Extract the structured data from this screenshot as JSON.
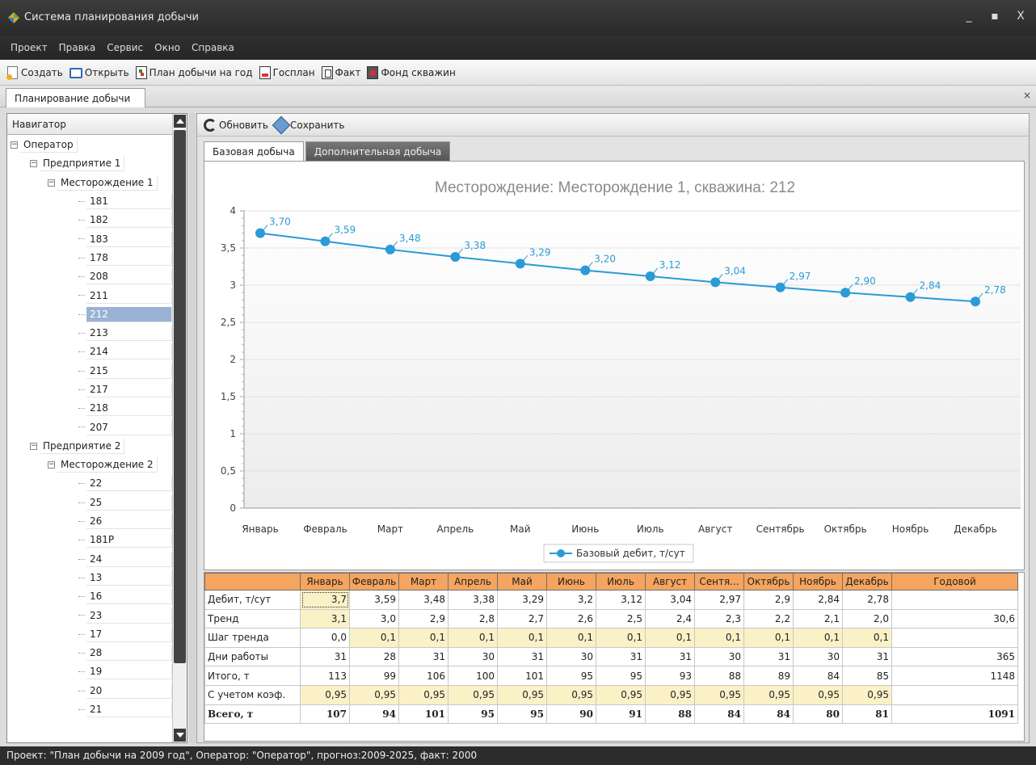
{
  "window": {
    "title": "Система планирования добычи",
    "controls": [
      "_",
      "▪",
      "X"
    ]
  },
  "menu": [
    "Проект",
    "Правка",
    "Сервис",
    "Окно",
    "Справка"
  ],
  "toolbar": {
    "create": "Создать",
    "open": "Открыть",
    "plan_year": "План добычи на год",
    "gosplan": "Госплан",
    "fact": "Факт",
    "well_fund": "Фонд скважин"
  },
  "doc_tab": {
    "label": "Планирование добычи",
    "close": "×"
  },
  "navigator": {
    "header": "Навигатор",
    "tree": [
      {
        "label": "Оператор",
        "level": 0,
        "expandable": true
      },
      {
        "label": "Предприятие 1",
        "level": 1,
        "expandable": true
      },
      {
        "label": "Месторождение 1",
        "level": 2,
        "expandable": true
      },
      {
        "label": "181",
        "level": 3
      },
      {
        "label": "182",
        "level": 3
      },
      {
        "label": "183",
        "level": 3
      },
      {
        "label": "178",
        "level": 3
      },
      {
        "label": "208",
        "level": 3
      },
      {
        "label": "211",
        "level": 3
      },
      {
        "label": "212",
        "level": 3,
        "selected": true
      },
      {
        "label": "213",
        "level": 3
      },
      {
        "label": "214",
        "level": 3
      },
      {
        "label": "215",
        "level": 3
      },
      {
        "label": "217",
        "level": 3
      },
      {
        "label": "218",
        "level": 3
      },
      {
        "label": "207",
        "level": 3
      },
      {
        "label": "Предприятие 2",
        "level": 1,
        "expandable": true
      },
      {
        "label": "Месторождение 2",
        "level": 2,
        "expandable": true
      },
      {
        "label": "22",
        "level": 3
      },
      {
        "label": "25",
        "level": 3
      },
      {
        "label": "26",
        "level": 3
      },
      {
        "label": "181P",
        "level": 3
      },
      {
        "label": "24",
        "level": 3
      },
      {
        "label": "13",
        "level": 3
      },
      {
        "label": "16",
        "level": 3
      },
      {
        "label": "23",
        "level": 3
      },
      {
        "label": "17",
        "level": 3
      },
      {
        "label": "28",
        "level": 3
      },
      {
        "label": "19",
        "level": 3
      },
      {
        "label": "20",
        "level": 3
      },
      {
        "label": "21",
        "level": 3
      }
    ]
  },
  "content_toolbar": {
    "refresh": "Обновить",
    "save": "Сохранить"
  },
  "tabs": [
    {
      "label": "Базовая добыча",
      "active": true
    },
    {
      "label": "Дополнительная добыча",
      "active": false
    }
  ],
  "chart_data": {
    "type": "line",
    "title": "Месторождение: Месторождение 1, скважина: 212",
    "categories": [
      "Январь",
      "Февраль",
      "Март",
      "Апрель",
      "Май",
      "Июнь",
      "Июль",
      "Август",
      "Сентябрь",
      "Октябрь",
      "Ноябрь",
      "Декабрь"
    ],
    "series": [
      {
        "name": "Базовый дебит, т/сут",
        "values": [
          3.7,
          3.59,
          3.48,
          3.38,
          3.29,
          3.2,
          3.12,
          3.04,
          2.97,
          2.9,
          2.84,
          2.78
        ],
        "labels": [
          "3,70",
          "3,59",
          "3,48",
          "3,38",
          "3,29",
          "3,20",
          "3,12",
          "3,04",
          "2,97",
          "2,90",
          "2,84",
          "2,78"
        ]
      }
    ],
    "ylim": [
      0,
      4
    ],
    "yticks": [
      0,
      0.5,
      1,
      1.5,
      2,
      2.5,
      3,
      3.5,
      4
    ],
    "ytick_labels": [
      "0",
      "0,5",
      "1",
      "1,5",
      "2",
      "2,5",
      "3",
      "3,5",
      "4"
    ],
    "grid": true,
    "legend": "bottom-center",
    "line_color": "#2a9bd6",
    "xlabel": "",
    "ylabel": ""
  },
  "table": {
    "headers": [
      "",
      "Январь",
      "Февраль",
      "Март",
      "Апрель",
      "Май",
      "Июнь",
      "Июль",
      "Август",
      "Сентя...",
      "Октябрь",
      "Ноябрь",
      "Декабрь",
      "Годовой"
    ],
    "rows": [
      {
        "label": "Дебит, т/сут",
        "values": [
          "3,7",
          "3,59",
          "3,48",
          "3,38",
          "3,29",
          "3,2",
          "3,12",
          "3,04",
          "2,97",
          "2,9",
          "2,84",
          "2,78",
          ""
        ]
      },
      {
        "label": "Тренд",
        "values": [
          "3,1",
          "3,0",
          "2,9",
          "2,8",
          "2,7",
          "2,6",
          "2,5",
          "2,4",
          "2,3",
          "2,2",
          "2,1",
          "2,0",
          "30,6"
        ]
      },
      {
        "label": "Шаг тренда",
        "values": [
          "0,0",
          "0,1",
          "0,1",
          "0,1",
          "0,1",
          "0,1",
          "0,1",
          "0,1",
          "0,1",
          "0,1",
          "0,1",
          "0,1",
          ""
        ]
      },
      {
        "label": "Дни работы",
        "values": [
          "31",
          "28",
          "31",
          "30",
          "31",
          "30",
          "31",
          "31",
          "30",
          "31",
          "30",
          "31",
          "365"
        ]
      },
      {
        "label": "Итого, т",
        "values": [
          "113",
          "99",
          "106",
          "100",
          "101",
          "95",
          "95",
          "93",
          "88",
          "89",
          "84",
          "85",
          "1148"
        ]
      },
      {
        "label": "С учетом коэф.",
        "values": [
          "0,95",
          "0,95",
          "0,95",
          "0,95",
          "0,95",
          "0,95",
          "0,95",
          "0,95",
          "0,95",
          "0,95",
          "0,95",
          "0,95",
          ""
        ]
      },
      {
        "label": "Всего, т",
        "values": [
          "107",
          "94",
          "101",
          "95",
          "95",
          "90",
          "91",
          "88",
          "84",
          "84",
          "80",
          "81",
          "1091"
        ],
        "bold": true
      }
    ]
  },
  "status": "Проект: \"План добычи на 2009 год\", Оператор: \"Оператор\", прогноз:2009-2025, факт: 2000",
  "colors": {
    "accent_orange": "#f5a55f",
    "selection": "#9bb2d6",
    "series_blue": "#2a9bd6",
    "editable_cell": "#fbf1c7"
  }
}
